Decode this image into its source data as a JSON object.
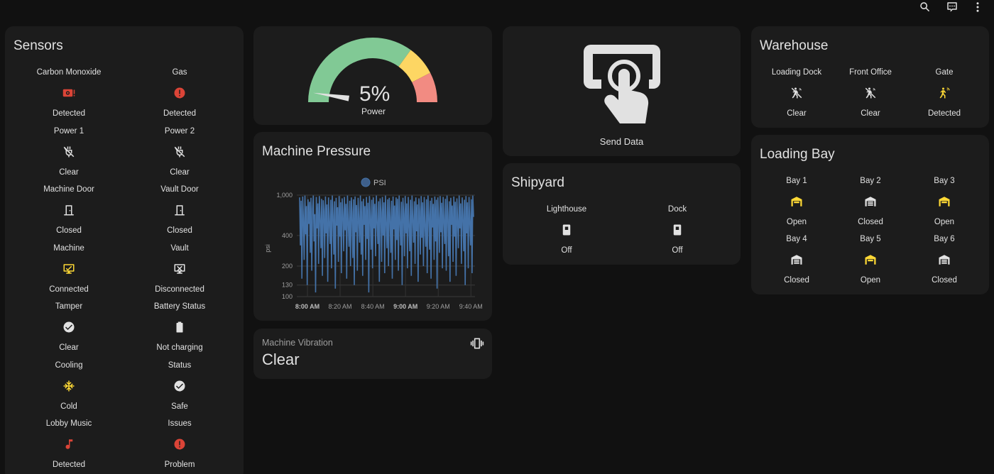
{
  "topbar": {
    "search_icon": "search-icon",
    "assist_icon": "comment-processing-icon",
    "menu_icon": "dots-vertical-icon"
  },
  "colors": {
    "red": "#db4437",
    "yellow": "#fdd835",
    "gray": "#e1e1e1",
    "card": "#1c1c1c",
    "bg": "#111111",
    "series": "#4472a8",
    "gauge_green": "#81c995",
    "gauge_yellow": "#fdd663",
    "gauge_red": "#f28b82"
  },
  "sensors": {
    "title": "Sensors",
    "items": [
      {
        "name": "Carbon Monoxide",
        "state": "Detected",
        "icon": "smoke-detector-alert-icon",
        "color": "red"
      },
      {
        "name": "Gas",
        "state": "Detected",
        "icon": "alert-circle-icon",
        "color": "red"
      },
      {
        "name": "Power 1",
        "state": "Clear",
        "icon": "power-plug-off-icon",
        "color": "gray"
      },
      {
        "name": "Power 2",
        "state": "Clear",
        "icon": "power-plug-off-icon",
        "color": "gray"
      },
      {
        "name": "Machine Door",
        "state": "Closed",
        "icon": "door-closed-icon",
        "color": "gray"
      },
      {
        "name": "Vault Door",
        "state": "Closed",
        "icon": "door-closed-icon",
        "color": "gray"
      },
      {
        "name": "Machine",
        "state": "Connected",
        "icon": "monitor-check-icon",
        "color": "yellow"
      },
      {
        "name": "Vault",
        "state": "Disconnected",
        "icon": "monitor-off-icon",
        "color": "gray"
      },
      {
        "name": "Tamper",
        "state": "Clear",
        "icon": "check-circle-icon",
        "color": "gray"
      },
      {
        "name": "Battery Status",
        "state": "Not charging",
        "icon": "battery-icon",
        "color": "gray"
      },
      {
        "name": "Cooling",
        "state": "Cold",
        "icon": "snowflake-icon",
        "color": "yellow"
      },
      {
        "name": "Status",
        "state": "Safe",
        "icon": "check-circle-icon",
        "color": "gray"
      },
      {
        "name": "Lobby Music",
        "state": "Detected",
        "icon": "music-note-icon",
        "color": "red"
      },
      {
        "name": "Issues",
        "state": "Problem",
        "icon": "alert-circle-icon",
        "color": "red"
      }
    ]
  },
  "gauge": {
    "value": 5,
    "value_text": "5%",
    "label": "Power",
    "min": 0,
    "max": 100,
    "severity": {
      "green": 0,
      "yellow": 70,
      "red": 85
    }
  },
  "send_data": {
    "label": "Send Data",
    "icon": "gesture-tap-button-icon"
  },
  "warehouse": {
    "title": "Warehouse",
    "items": [
      {
        "name": "Loading Dock",
        "state": "Clear",
        "icon": "motion-sensor-off-icon",
        "color": "gray"
      },
      {
        "name": "Front Office",
        "state": "Clear",
        "icon": "motion-sensor-off-icon",
        "color": "gray"
      },
      {
        "name": "Gate",
        "state": "Detected",
        "icon": "motion-sensor-icon",
        "color": "yellow"
      }
    ]
  },
  "loading_bay": {
    "title": "Loading Bay",
    "items": [
      {
        "name": "Bay 1",
        "state": "Open",
        "icon": "garage-open-icon",
        "color": "yellow"
      },
      {
        "name": "Bay 2",
        "state": "Closed",
        "icon": "garage-icon",
        "color": "gray"
      },
      {
        "name": "Bay 3",
        "state": "Open",
        "icon": "garage-open-icon",
        "color": "yellow"
      },
      {
        "name": "Bay 4",
        "state": "Closed",
        "icon": "garage-icon",
        "color": "gray"
      },
      {
        "name": "Bay 5",
        "state": "Open",
        "icon": "garage-open-icon",
        "color": "yellow"
      },
      {
        "name": "Bay 6",
        "state": "Closed",
        "icon": "garage-icon",
        "color": "gray"
      }
    ]
  },
  "shipyard": {
    "title": "Shipyard",
    "items": [
      {
        "name": "Lighthouse",
        "state": "Off",
        "icon": "light-switch-icon",
        "color": "gray"
      },
      {
        "name": "Dock",
        "state": "Off",
        "icon": "light-switch-icon",
        "color": "gray"
      }
    ]
  },
  "vibration": {
    "label": "Machine Vibration",
    "state": "Clear",
    "icon": "vibrate-icon"
  },
  "chart_data": {
    "type": "line",
    "title": "Machine Pressure",
    "legend": [
      "PSI"
    ],
    "legend_placement": "top-center",
    "ylabel": "psi",
    "xlabel": "",
    "yscale": "log",
    "ylim": [
      100,
      1000
    ],
    "yticks": [
      "1,000",
      "400",
      "200",
      "130",
      "100"
    ],
    "ytick_values": [
      1000,
      400,
      200,
      130,
      100
    ],
    "xticks": [
      "8:00 AM",
      "8:20 AM",
      "8:40 AM",
      "9:00 AM",
      "9:20 AM",
      "9:40 AM"
    ],
    "xticks_bold": [
      true,
      false,
      false,
      true,
      false,
      false
    ],
    "x_minutes_from_start": [
      0,
      20,
      40,
      60,
      80,
      100
    ],
    "grid": true,
    "series": [
      {
        "name": "PSI",
        "values": [
          950,
          320,
          880,
          150,
          970,
          600,
          230,
          990,
          410,
          780,
          130,
          910,
          520,
          860,
          270,
          940,
          180,
          730,
          990,
          350,
          650,
          110,
          960,
          470,
          830,
          210,
          980,
          580,
          300,
          920,
          160,
          890,
          700,
          240,
          970,
          420,
          810,
          140,
          950,
          560,
          330,
          900,
          190,
          990,
          620,
          260,
          870,
          120,
          940,
          500,
          760,
          220,
          980,
          390,
          850,
          170,
          930,
          640,
          280,
          960,
          450,
          820,
          150,
          990,
          540,
          310,
          880,
          200,
          950,
          690,
          240,
          910,
          130,
          970,
          430,
          800,
          180,
          940,
          590,
          340,
          990,
          260,
          870,
          160,
          920,
          510,
          780,
          230,
          960,
          370,
          840,
          110,
          980,
          620,
          290,
          900,
          190,
          950,
          470,
          820,
          250,
          990,
          560,
          330,
          870,
          140,
          930,
          680,
          220,
          960,
          400,
          850,
          170,
          990,
          530,
          300,
          910,
          200,
          940,
          610,
          270,
          880,
          150,
          970,
          460,
          790,
          230,
          950,
          360,
          920,
          180,
          990,
          570,
          320,
          860,
          130,
          940,
          650,
          250,
          980,
          420,
          830,
          190,
          960,
          500,
          280,
          900,
          160,
          990,
          590,
          340,
          870,
          210,
          950,
          440,
          810,
          140,
          930,
          700,
          260,
          980,
          380,
          850,
          200,
          960,
          520,
          310,
          910,
          170,
          990,
          630,
          290,
          880,
          150,
          940,
          480,
          820,
          230,
          970,
          350,
          900,
          120,
          950,
          600,
          270,
          980,
          430,
          840,
          190,
          960,
          560,
          330,
          920,
          180,
          990,
          660,
          250,
          870,
          140,
          940,
          510,
          790,
          220,
          970,
          390,
          860,
          160,
          930,
          580,
          300,
          990,
          470,
          830,
          210,
          950,
          640,
          280,
          900,
          130,
          980,
          420,
          850,
          190,
          960,
          540,
          320,
          910,
          170,
          990,
          610
        ]
      }
    ]
  }
}
